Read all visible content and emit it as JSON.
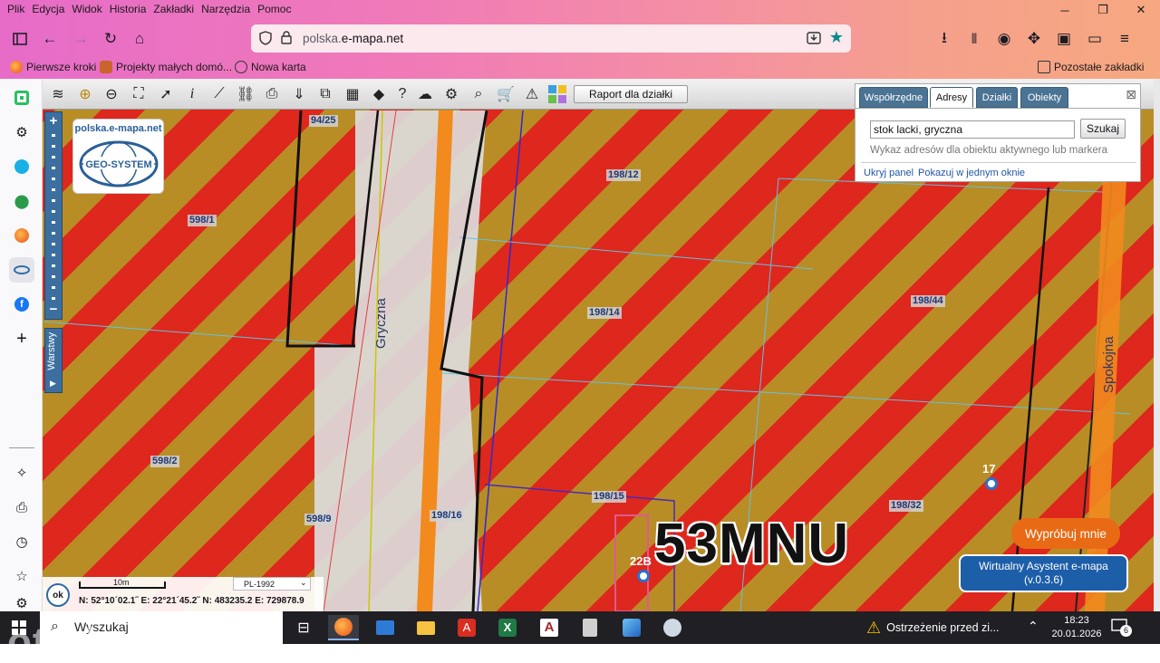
{
  "menu": [
    "Plik",
    "Edycja",
    "Widok",
    "Historia",
    "Zakładki",
    "Narzędzia",
    "Pomoc"
  ],
  "address_bar": {
    "url_prefix": "polska.",
    "url_domain": "e-mapa.net"
  },
  "bookmarks": [
    {
      "label": "Pierwsze kroki",
      "icon": "firefox-icon"
    },
    {
      "label": "Projekty małych domó...",
      "icon": "folder-image-icon"
    },
    {
      "label": "Nowa karta",
      "icon": "globe-icon"
    }
  ],
  "other_bookmarks": "Pozostałe zakładki",
  "map_toolbar": {
    "report_button": "Raport dla działki"
  },
  "logo": {
    "site": "polska.e-mapa.net",
    "brand": "GEO-SYSTEM"
  },
  "zoom": {
    "plus": "+",
    "minus": "−"
  },
  "layers_tab": "Warstwy",
  "parcels": [
    "94/25",
    "598/1",
    "198/12",
    "198/14",
    "198/44",
    "598/2",
    "598/9",
    "198/16",
    "198/15",
    "198/32"
  ],
  "streets": {
    "gryczna": "Gryczna",
    "spokojna": "Spokojna"
  },
  "house_numbers": {
    "n17": "17",
    "n22b": "22B"
  },
  "zone_label": "53MNU",
  "panel": {
    "tabs": [
      "Współrzędne",
      "Adresy",
      "Działki",
      "Obiekty"
    ],
    "active_tab": "Adresy",
    "search_value": "stok lacki, gryczna",
    "search_button": "Szukaj",
    "hint": "Wykaz adresów dla obiektu aktywnego lub markera",
    "link_hide": "Ukryj panel",
    "link_one_window": "Pokazuj w jednym oknie"
  },
  "assistant": {
    "cta": "Wypróbuj mnie",
    "line1": "Wirtualny Asystent e-mapa",
    "line2": "(v.0.3.6)"
  },
  "coords": {
    "ok": "ok",
    "scale": "10m",
    "projection": "PL-1992",
    "values": "N: 52°10´02.1˝  E: 22°21´45.2˝   N: 483235.2   E: 729878.9"
  },
  "taskbar": {
    "search_placeholder": "Wyszukaj",
    "warning": "Ostrzeżenie przed zi...",
    "time": "18:23",
    "date": "20.01.2026",
    "notifications": "6"
  },
  "watermark": "otodom",
  "colors": {
    "hatch_red": "#e0221c",
    "hatch_gold": "#b98d26",
    "assistant_blue": "#1d5ea8",
    "cta_orange": "#e96a14"
  }
}
